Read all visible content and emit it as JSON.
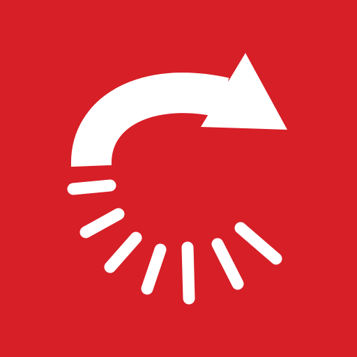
{
  "icon": {
    "name": "redo-arrow-loading-icon",
    "background_color": "#D71F27",
    "foreground_color": "#FFFFFF"
  }
}
